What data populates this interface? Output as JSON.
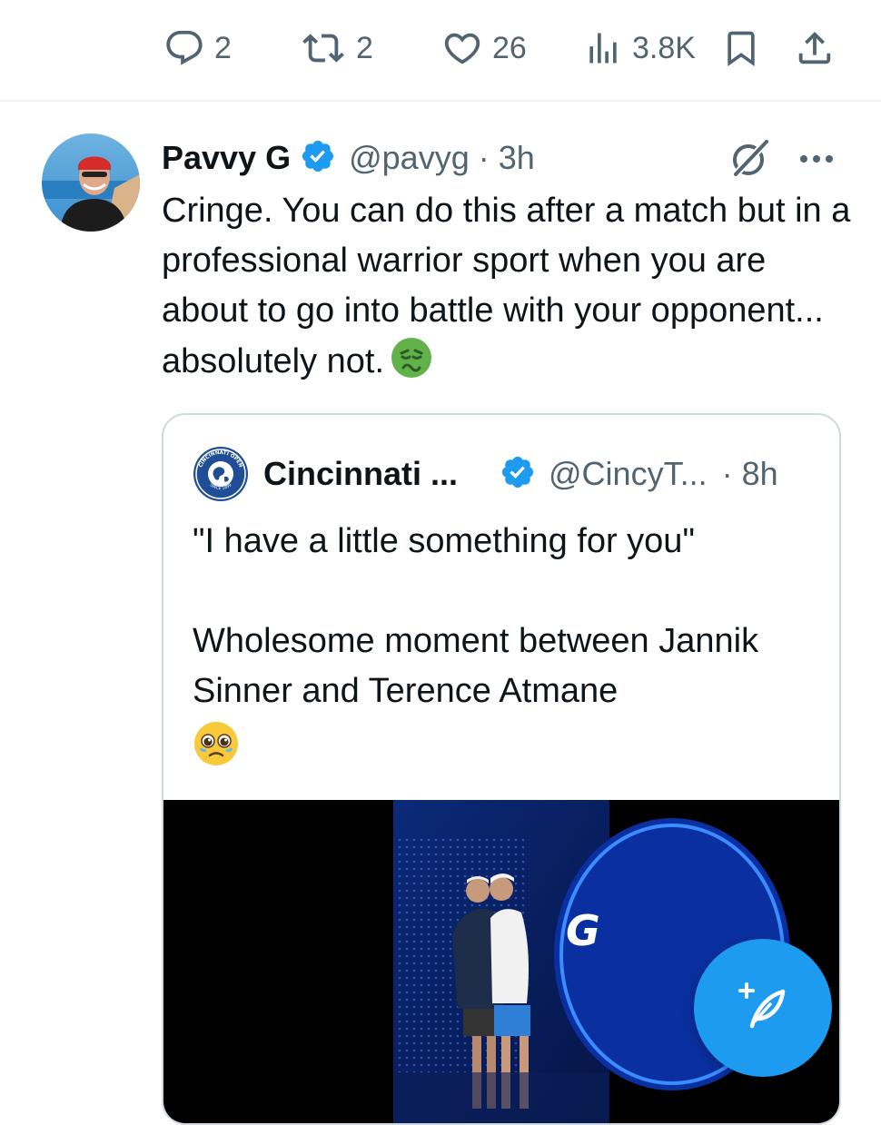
{
  "actions": {
    "replies": "2",
    "reposts": "2",
    "likes": "26",
    "views": "3.8K"
  },
  "icons": {
    "reply": "reply-icon",
    "repost": "repost-icon",
    "like": "heart-icon",
    "views": "views-icon",
    "bookmark": "bookmark-icon",
    "share": "share-icon",
    "verified": "verified-badge-icon",
    "grok": "grok-icon",
    "more": "more-icon",
    "compose": "compose-post-icon"
  },
  "tweet": {
    "author_name": "Pavvy G",
    "handle_time": "@pavyg · 3h",
    "text": "Cringe. You can do this after a match but in a professional warrior sport when you are about to go into battle with your opponent... absolutely not.",
    "emoji": "🤮"
  },
  "quote": {
    "author_name": "Cincinnati ...",
    "handle": "@CincyT...",
    "time": "· 8h",
    "line1": "\"I have a little something for you\"",
    "line2": "Wholesome moment between Jannik Sinner and Terence Atmane",
    "emoji": "🥹",
    "logo_text_top": "CINCINNATI OPEN",
    "logo_text_bottom": "SINCE 1899",
    "media_sign": "G"
  },
  "colors": {
    "accent": "#1d9bf0",
    "secondary_text": "#536471",
    "primary_text": "#0f1419",
    "border": "#cfd9de"
  }
}
